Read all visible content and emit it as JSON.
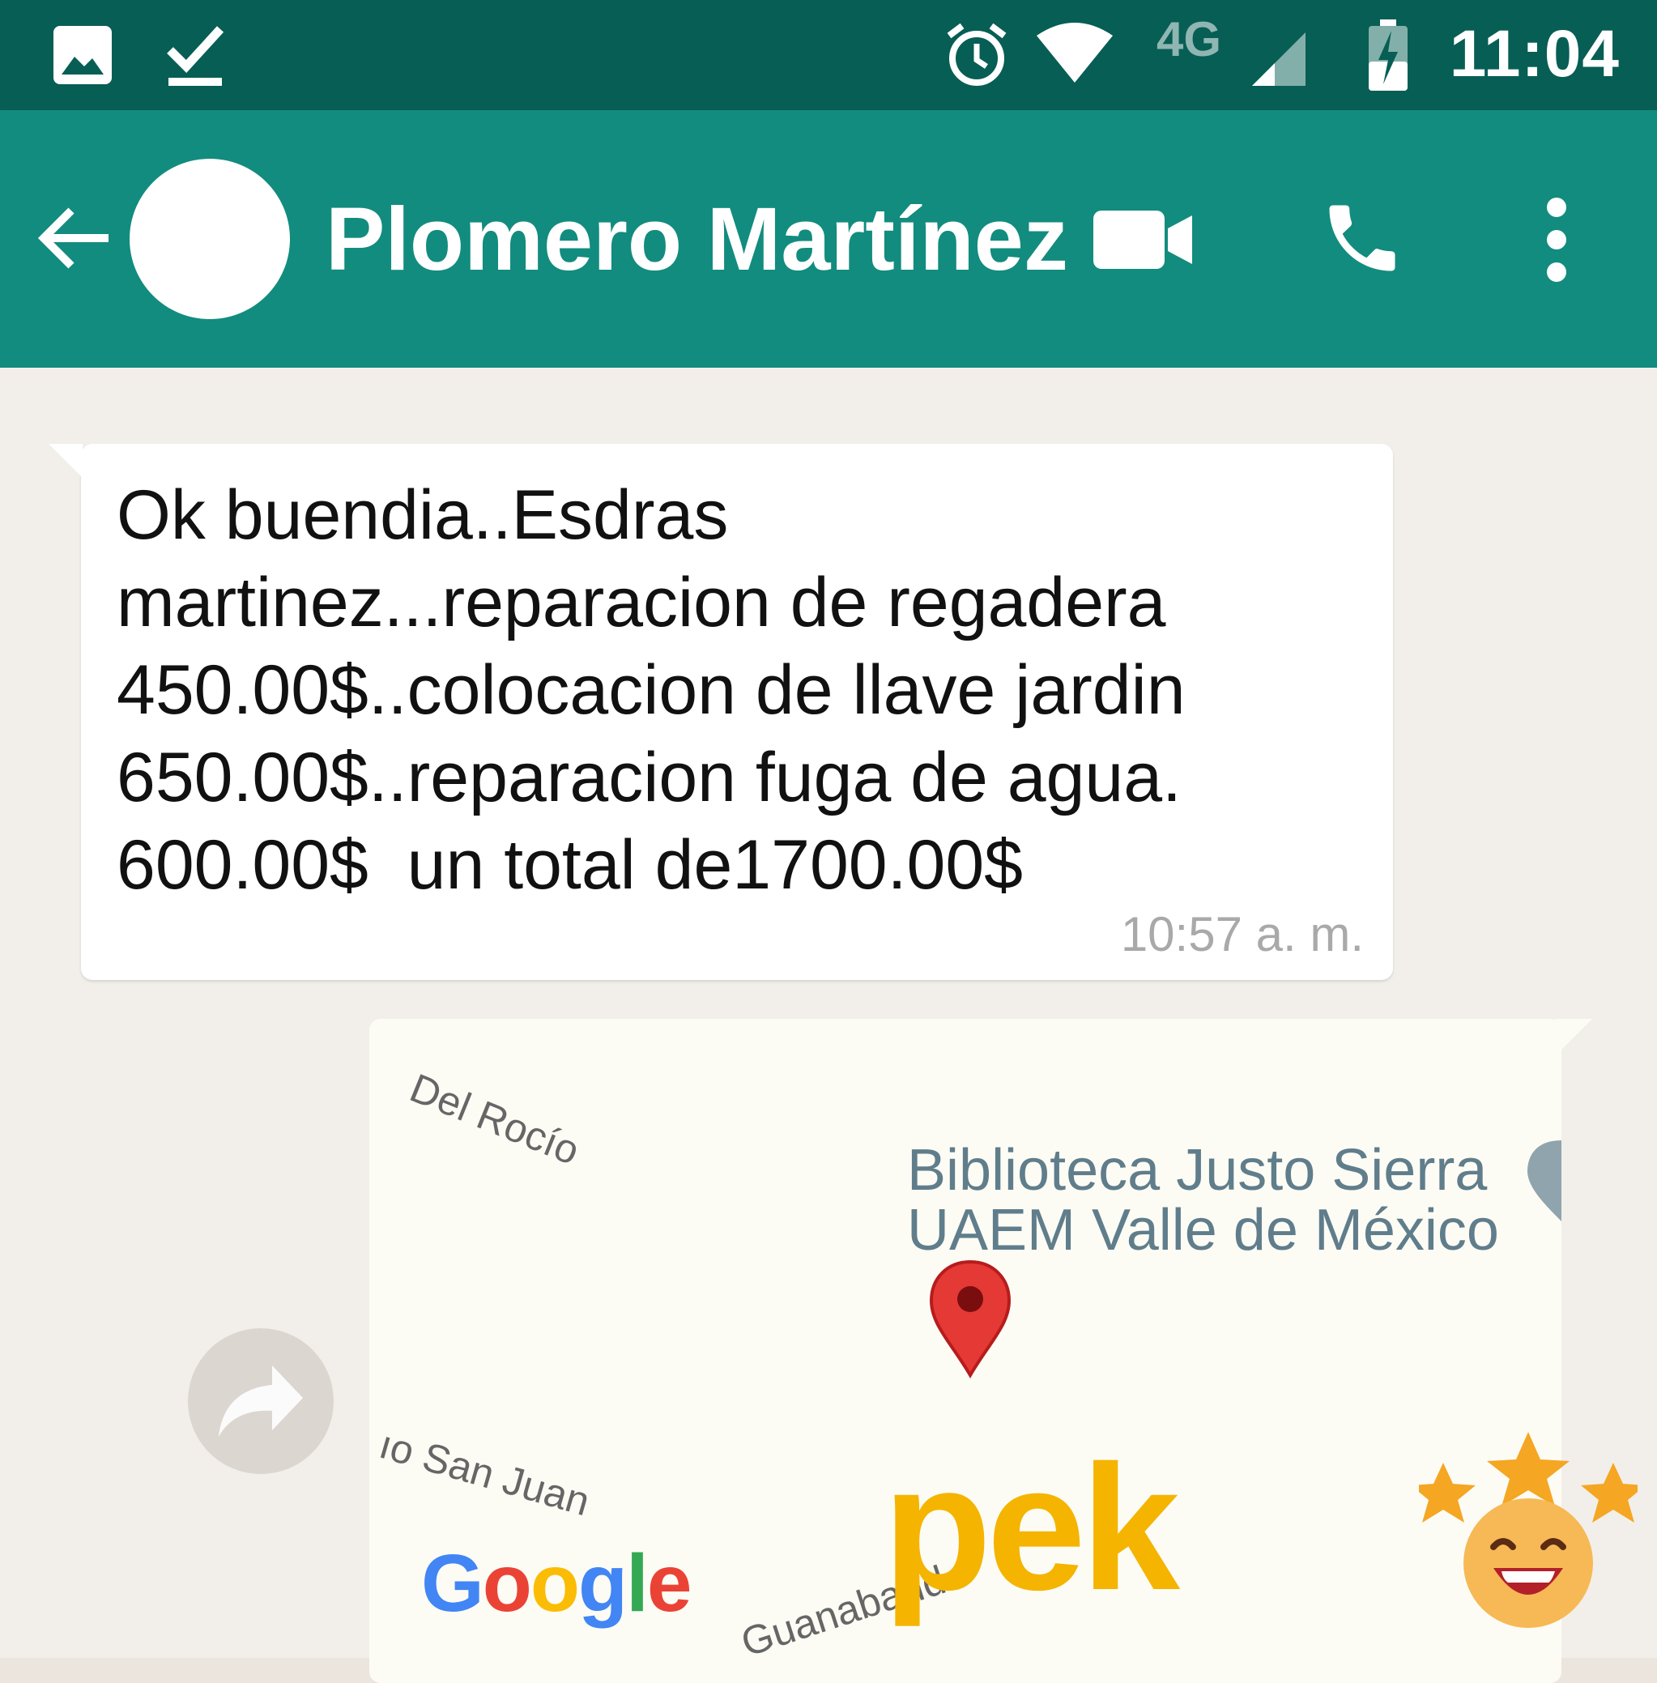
{
  "status_bar": {
    "time": "11:04",
    "network": "4G",
    "icons": [
      "gallery-icon",
      "download-done-icon",
      "alarm-icon",
      "wifi-icon",
      "signal-icon",
      "battery-charging-icon"
    ]
  },
  "header": {
    "contact_name": "Plomero Martínez",
    "icons": [
      "back-arrow-icon",
      "video-call-icon",
      "phone-icon",
      "more-vert-icon"
    ]
  },
  "messages": [
    {
      "direction": "incoming",
      "lines": [
        "Ok buendia..Esdras",
        "martinez...reparacion de regadera",
        "450.00$..colocacion de llave jardin",
        "650.00$..reparacion fuga de agua.",
        "600.00$  un total de1700.00$"
      ],
      "time": "10:57 a. m."
    },
    {
      "direction": "outgoing",
      "type": "location",
      "map_labels": {
        "street_1": "Del Rocío",
        "street_2": "ıo San Juan",
        "street_3": "Guanaband",
        "poi_line_1": "Biblioteca Justo Sierra",
        "poi_line_2": "UAEM Valle de México"
      },
      "attribution": "Google"
    }
  ],
  "watermark": {
    "text": "pek"
  },
  "colors": {
    "status_bar": "#075e54",
    "app_bar": "#128c7e",
    "chat_bg": "#f2efea",
    "pin": "#e53935",
    "watermark": "#f5b400"
  }
}
